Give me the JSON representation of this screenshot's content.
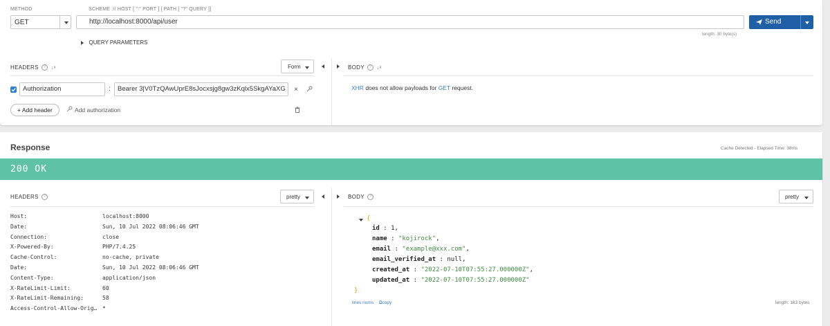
{
  "request": {
    "method_label": "METHOD",
    "method_value": "GET",
    "url_label": "SCHEME :// HOST [ \":\" PORT ] [ PATH [ \"?\" QUERY ]]",
    "url_value": "http://localhost:8000/api/user",
    "url_length": "length: 30 byte(s)",
    "send_label": "Send",
    "query_params_label": "QUERY PARAMETERS",
    "headers_label": "HEADERS",
    "headers_mode": "Form",
    "body_label": "BODY",
    "header_rows": [
      {
        "enabled": true,
        "name": "Authorization",
        "value": "Bearer 3|V0TzQAwUprE8sJocxsjg8gw3zKqlx5SkgAYaXG"
      }
    ],
    "add_header_label": "+ Add header",
    "add_authorization_label": "Add authorization",
    "body_message": {
      "prefix": "XHR",
      "middle": " does not allow payloads for ",
      "method": "GET",
      "suffix": " request."
    }
  },
  "response": {
    "title": "Response",
    "cache_info": "Cache Detected - Elapsed Time: 38ms",
    "status_text": "200 OK",
    "status_color": "#5ec2a6",
    "headers_label": "HEADERS",
    "headers_format": "pretty",
    "body_label": "BODY",
    "body_format": "pretty",
    "headers": [
      {
        "key": "Host:",
        "value": "localhost:8000"
      },
      {
        "key": "Date:",
        "value": "Sun, 10 Jul 2022 08:06:46 GMT"
      },
      {
        "key": "Connection:",
        "value": "close"
      },
      {
        "key": "X-Powered-By:",
        "value": "PHP/7.4.25"
      },
      {
        "key": "Cache-Control:",
        "value": "no-cache, private"
      },
      {
        "key": "Date:",
        "value": "Sun, 10 Jul 2022 08:06:46 GMT"
      },
      {
        "key": "Content-Type:",
        "value": "application/json"
      },
      {
        "key": "X-RateLimit-Limit:",
        "value": "60"
      },
      {
        "key": "X-RateLimit-Remaining:",
        "value": "58"
      },
      {
        "key": "Access-Control-Allow-Orig…",
        "value": "*"
      }
    ],
    "json": {
      "open_brace": "{",
      "close_brace": "}",
      "fields": [
        {
          "key": "id",
          "value": "1",
          "type": "number"
        },
        {
          "key": "name",
          "value": "\"kojirock\"",
          "type": "string"
        },
        {
          "key": "email",
          "value": "\"example@xxx.com\"",
          "type": "string"
        },
        {
          "key": "email_verified_at",
          "value": "null",
          "type": "null"
        },
        {
          "key": "created_at",
          "value": "\"2022-07-10T07:55:27.000000Z\"",
          "type": "string"
        },
        {
          "key": "updated_at",
          "value": "\"2022-07-10T07:55:27.000000Z\"",
          "type": "string"
        }
      ]
    },
    "lines_nums_label": "lines nums",
    "copy_label": "copy",
    "body_length": "length: 163 bytes"
  }
}
